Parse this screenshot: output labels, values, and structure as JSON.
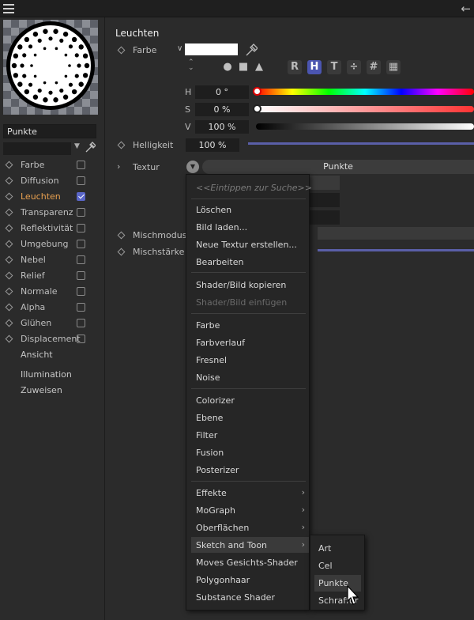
{
  "left_panel": {
    "material_name": "Punkte",
    "channels": [
      {
        "label": "Farbe",
        "checked": false,
        "active": false
      },
      {
        "label": "Diffusion",
        "checked": false,
        "active": false
      },
      {
        "label": "Leuchten",
        "checked": true,
        "active": true
      },
      {
        "label": "Transparenz",
        "checked": false,
        "active": false
      },
      {
        "label": "Reflektivität",
        "checked": false,
        "active": false
      },
      {
        "label": "Umgebung",
        "checked": false,
        "active": false
      },
      {
        "label": "Nebel",
        "checked": false,
        "active": false
      },
      {
        "label": "Relief",
        "checked": false,
        "active": false
      },
      {
        "label": "Normale",
        "checked": false,
        "active": false
      },
      {
        "label": "Alpha",
        "checked": false,
        "active": false
      },
      {
        "label": "Glühen",
        "checked": false,
        "active": false
      },
      {
        "label": "Displacement",
        "checked": false,
        "active": false
      }
    ],
    "extra_items": [
      "Ansicht",
      "Illumination",
      "Zuweisen"
    ]
  },
  "properties": {
    "section_title": "Leuchten",
    "farbe_label": "Farbe",
    "swatch_color": "#ffffff",
    "mode_buttons": [
      "R",
      "H",
      "T",
      "÷",
      "#",
      "▦"
    ],
    "active_mode": "H",
    "hsv": [
      {
        "label": "H",
        "value": "0 °"
      },
      {
        "label": "S",
        "value": "0 %"
      },
      {
        "label": "V",
        "value": "100 %"
      }
    ],
    "helligkeit_label": "Helligkeit",
    "helligkeit_value": "100 %",
    "textur_label": "Textur",
    "textur_value": "Punkte",
    "mischmodus_label": "Mischmodus",
    "mischstaerke_label": "Mischstärke"
  },
  "context_menu": {
    "search_placeholder": "<<Eintippen zur Suche>>",
    "items": [
      "Löschen",
      "Bild laden...",
      "Neue Textur erstellen...",
      "Bearbeiten",
      "Shader/Bild kopieren",
      "Shader/Bild einfügen",
      "Farbe",
      "Farbverlauf",
      "Fresnel",
      "Noise",
      "Colorizer",
      "Ebene",
      "Filter",
      "Fusion",
      "Posterizer",
      "Effekte",
      "MoGraph",
      "Oberflächen",
      "Sketch and Toon",
      "Moves Gesichts-Shader",
      "Polygonhaar",
      "Substance Shader"
    ]
  },
  "submenu": {
    "items": [
      "Art",
      "Cel",
      "Punkte",
      "Schraffur"
    ],
    "highlighted": "Punkte"
  },
  "colors": {
    "accent": "#4b55b0",
    "active_channel": "#e8a050"
  }
}
